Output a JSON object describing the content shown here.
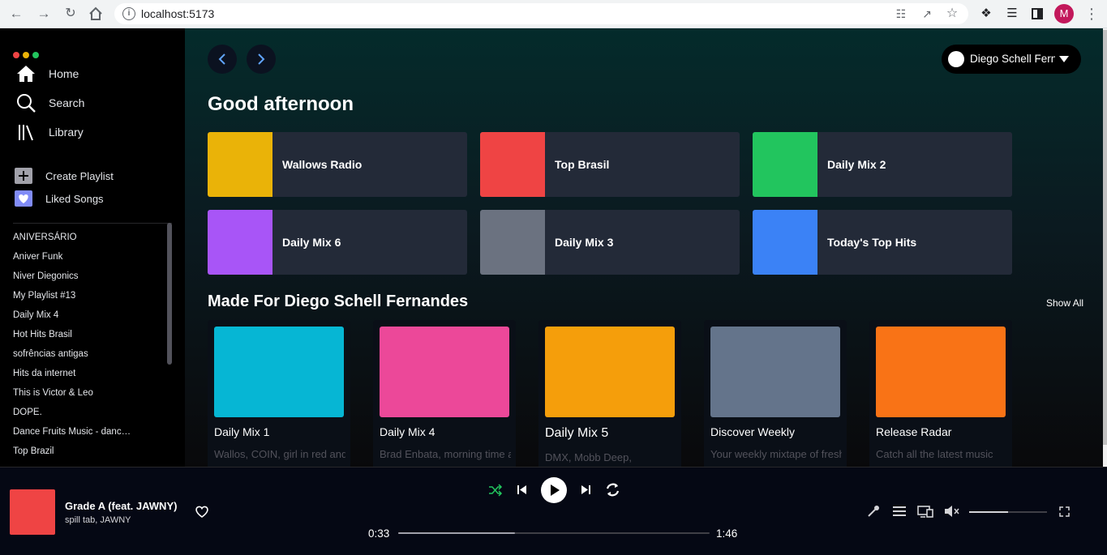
{
  "browser": {
    "url": "localhost:5173",
    "profile_initial": "M",
    "icons": [
      "back-arrow-icon",
      "forward-arrow-icon",
      "reload-icon",
      "home-icon",
      "info-icon",
      "translate-icon",
      "share-icon",
      "star-icon",
      "extensions-icon",
      "media-icon",
      "side-panel-icon",
      "menu-icon"
    ]
  },
  "sidebar": {
    "window_dots": [
      "#ef4444",
      "#eab308",
      "#22c55e"
    ],
    "nav": [
      {
        "label": "Home",
        "icon": "home-icon"
      },
      {
        "label": "Search",
        "icon": "search-icon"
      },
      {
        "label": "Library",
        "icon": "library-icon"
      }
    ],
    "actions": [
      {
        "label": "Create Playlist",
        "icon": "plus-icon"
      },
      {
        "label": "Liked Songs",
        "icon": "heart-icon"
      }
    ],
    "playlists": [
      "ANIVERSÁRIO",
      "Aniver Funk",
      "Niver Diegonics",
      "My Playlist #13",
      "Daily Mix 4",
      "Hot Hits Brasil",
      "sofrências antigas",
      "Hits da internet",
      "This is Victor & Leo",
      "DOPE.",
      "Dance Fruits Music - dance music",
      "Top Brazil"
    ]
  },
  "main": {
    "user_name": "Diego Schell Fernandes",
    "greeting": "Good afternoon",
    "quick_picks": [
      {
        "title": "Wallows Radio",
        "color": "#eab308"
      },
      {
        "title": "Top Brasil",
        "color": "#ef4444"
      },
      {
        "title": "Daily Mix 2",
        "color": "#22c55e"
      },
      {
        "title": "Daily Mix 6",
        "color": "#a855f7"
      },
      {
        "title": "Daily Mix 3",
        "color": "#6b7280"
      },
      {
        "title": "Today's Top Hits",
        "color": "#3b82f6"
      }
    ],
    "section_title": "Made For Diego Schell Fernandes",
    "show_all": "Show All",
    "cards": [
      {
        "title": "Daily Mix 1",
        "subtitle": "Wallos, COIN, girl in red and more",
        "color": "#06b6d4"
      },
      {
        "title": "Daily Mix 4",
        "subtitle": "Brad Enbata, morning time and more",
        "color": "#ec4899"
      },
      {
        "title": "Daily Mix 5",
        "subtitle": "DMX, Mobb Deep,",
        "color": "#f59e0b"
      },
      {
        "title": "Discover Weekly",
        "subtitle": "Your weekly mixtape of fresh music",
        "color": "#64748b"
      },
      {
        "title": "Release Radar",
        "subtitle": "Catch all the latest music",
        "color": "#f97316"
      }
    ]
  },
  "player": {
    "track_title": "Grade A (feat. JAWNY)",
    "track_artist": "spill tab, JAWNY",
    "art_color": "#ef4444",
    "elapsed": "0:33",
    "duration": "1:46",
    "progress_fraction": 0.375,
    "volume_fraction": 0.5,
    "accent_color": "#22c55e",
    "icons": [
      "heart-icon",
      "shuffle-icon",
      "skip-back-icon",
      "play-icon",
      "skip-forward-icon",
      "repeat-icon",
      "microphone-icon",
      "queue-icon",
      "devices-icon",
      "volume-icon",
      "fullscreen-icon"
    ]
  }
}
